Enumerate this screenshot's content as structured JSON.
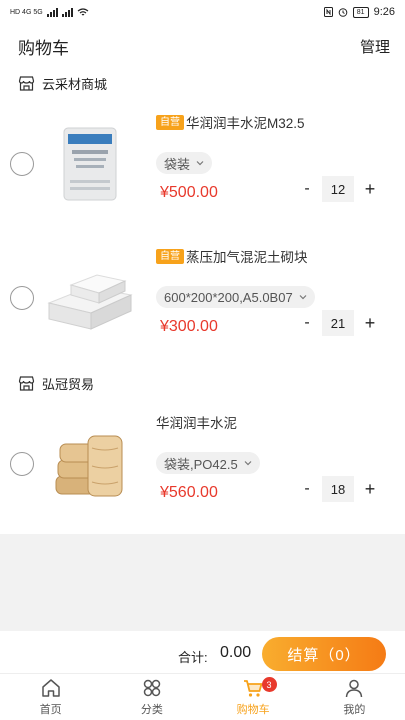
{
  "status_bar": {
    "left_text": "HD 4G 5G",
    "battery": "81",
    "time": "9:26"
  },
  "header": {
    "title": "购物车",
    "manage": "管理"
  },
  "shops": [
    {
      "name": "云采材商城",
      "items": [
        {
          "tag": "自营",
          "name": "华润润丰水泥M32.5",
          "spec": "袋装",
          "price": "¥500.00",
          "qty": "12",
          "image": "cement-bag"
        },
        {
          "tag": "自营",
          "name": "蒸压加气混泥土砌块",
          "spec": "600*200*200,A5.0B07",
          "price": "¥300.00",
          "qty": "21",
          "image": "aerated-block"
        }
      ]
    },
    {
      "name": "弘冠贸易",
      "items": [
        {
          "tag": "",
          "name": "华润润丰水泥",
          "spec": "袋装,PO42.5",
          "price": "¥560.00",
          "qty": "18",
          "image": "cement-bags-stack"
        }
      ]
    }
  ],
  "stepper": {
    "minus": "-",
    "plus": "+"
  },
  "footer": {
    "total_label": "合计:",
    "total_value": "0.00",
    "checkout": "结算（0）"
  },
  "tabbar": {
    "items": [
      {
        "label": "首页",
        "icon": "home-icon"
      },
      {
        "label": "分类",
        "icon": "category-icon"
      },
      {
        "label": "购物车",
        "icon": "cart-icon",
        "badge": "3"
      },
      {
        "label": "我的",
        "icon": "user-icon"
      }
    ]
  },
  "colors": {
    "accent": "#f7a21b",
    "price": "#e8392c",
    "checkout_start": "#f9ad2e",
    "checkout_end": "#f57b15"
  }
}
